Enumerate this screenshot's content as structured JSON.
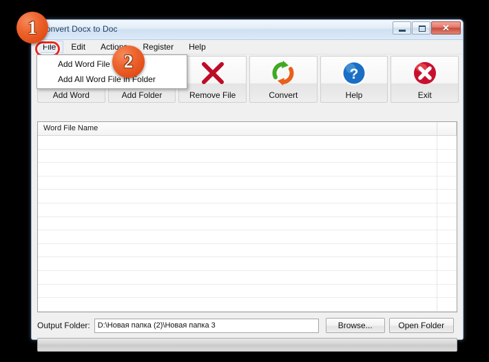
{
  "window": {
    "title": "Convert Docx to Doc",
    "controls": {
      "minimize": "minimize",
      "maximize": "maximize",
      "close": "✕"
    }
  },
  "menubar": {
    "items": [
      {
        "label": "File",
        "active": true
      },
      {
        "label": "Edit",
        "active": false
      },
      {
        "label": "Actions",
        "active": false
      },
      {
        "label": "Register",
        "active": false
      },
      {
        "label": "Help",
        "active": false
      }
    ]
  },
  "dropdown": {
    "open_menu": "File",
    "items": [
      {
        "label": "Add Word File",
        "highlighted": true
      },
      {
        "label": "Add All Word File in Folder",
        "highlighted": false
      }
    ]
  },
  "toolbar": {
    "buttons": [
      {
        "label": "Add Word",
        "icon": "word-document-icon"
      },
      {
        "label": "Add Folder",
        "icon": "folder-icon"
      },
      {
        "label": "Remove File",
        "icon": "red-x-icon"
      },
      {
        "label": "Convert",
        "icon": "circular-arrows-icon"
      },
      {
        "label": "Help",
        "icon": "blue-question-mark-icon"
      },
      {
        "label": "Exit",
        "icon": "red-sphere-x-icon"
      }
    ]
  },
  "listview": {
    "columns": [
      "Word File Name",
      ""
    ],
    "rows": [],
    "empty_row_count": 13
  },
  "output": {
    "label": "Output Folder:",
    "value": "D:\\Новая папка (2)\\Новая папка 3",
    "placeholder": "",
    "browse_label": "Browse...",
    "open_folder_label": "Open Folder"
  },
  "progress": {
    "value": 0
  },
  "annotations": {
    "badges": [
      {
        "number": "1",
        "target": "File menu"
      },
      {
        "number": "2",
        "target": "Add Word File menu item"
      }
    ],
    "highlight_color": "#e8291c",
    "badge_color": "#e4501b"
  }
}
